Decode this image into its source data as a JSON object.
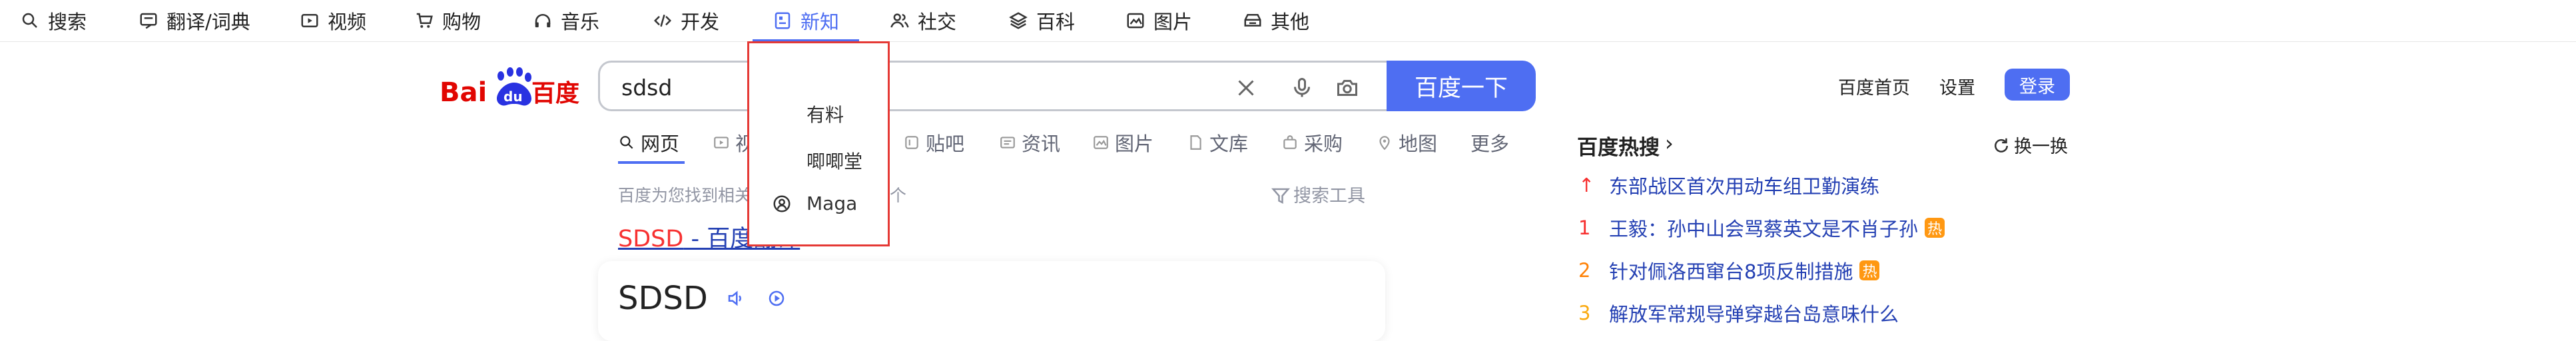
{
  "top_nav": {
    "items": [
      {
        "label": "搜索",
        "icon": "search-icon"
      },
      {
        "label": "翻译/词典",
        "icon": "translate-icon"
      },
      {
        "label": "视频",
        "icon": "video-icon"
      },
      {
        "label": "购物",
        "icon": "cart-icon"
      },
      {
        "label": "音乐",
        "icon": "headphones-icon"
      },
      {
        "label": "开发",
        "icon": "code-icon"
      },
      {
        "label": "新知",
        "icon": "news-icon"
      },
      {
        "label": "社交",
        "icon": "people-icon"
      },
      {
        "label": "百科",
        "icon": "layers-icon"
      },
      {
        "label": "图片",
        "icon": "image-icon"
      },
      {
        "label": "其他",
        "icon": "more-box-icon"
      }
    ],
    "active": "新知",
    "accent_color": "#4e6ef2"
  },
  "logo": {
    "text_left": "Bai",
    "text_paw": "du",
    "text_right": "百度",
    "color_red": "#e10602",
    "color_blue": "#2932e1"
  },
  "search": {
    "value": "sdsd",
    "button_label": "百度一下"
  },
  "header_right": {
    "home_label": "百度首页",
    "settings_label": "设置",
    "login_label": "登录"
  },
  "tabs": [
    {
      "label": "网页",
      "icon": "search-icon"
    },
    {
      "label": "视",
      "icon": "video-icon"
    },
    {
      "label": "贴吧",
      "icon": "tieba-icon"
    },
    {
      "label": "资讯",
      "icon": "news-icon"
    },
    {
      "label": "图片",
      "icon": "image-icon"
    },
    {
      "label": "文库",
      "icon": "doc-icon"
    },
    {
      "label": "采购",
      "icon": "bag-icon"
    },
    {
      "label": "地图",
      "icon": "map-icon"
    },
    {
      "label": "更多",
      "icon": ""
    }
  ],
  "result_count_text": "百度为您找到相关",
  "result_count_suffix": "个",
  "search_tools_label": "搜索工具",
  "result1": {
    "highlight": "SDSD",
    "rest": " - 百度翻译"
  },
  "card_word": "SDSD",
  "dropdown": {
    "items": [
      {
        "label": "有料"
      },
      {
        "label": "唧唧堂"
      },
      {
        "label": "Maga",
        "icon": "maga-icon"
      }
    ]
  },
  "hot": {
    "title": "百度热搜",
    "refresh_label": "换一换",
    "items": [
      {
        "rank": "↑",
        "text": "东部战区首次用动车组卫勤演练",
        "badge": ""
      },
      {
        "rank": "1",
        "text": "王毅：孙中山会骂蔡英文是不肖子孙",
        "badge": "热"
      },
      {
        "rank": "2",
        "text": "针对佩洛西窜台8项反制措施",
        "badge": "热"
      },
      {
        "rank": "3",
        "text": "解放军常规导弹穿越台岛意味什么",
        "badge": ""
      }
    ],
    "rank_colors": [
      "#f73131",
      "#f73131",
      "#ff8105",
      "#faa90e"
    ]
  }
}
